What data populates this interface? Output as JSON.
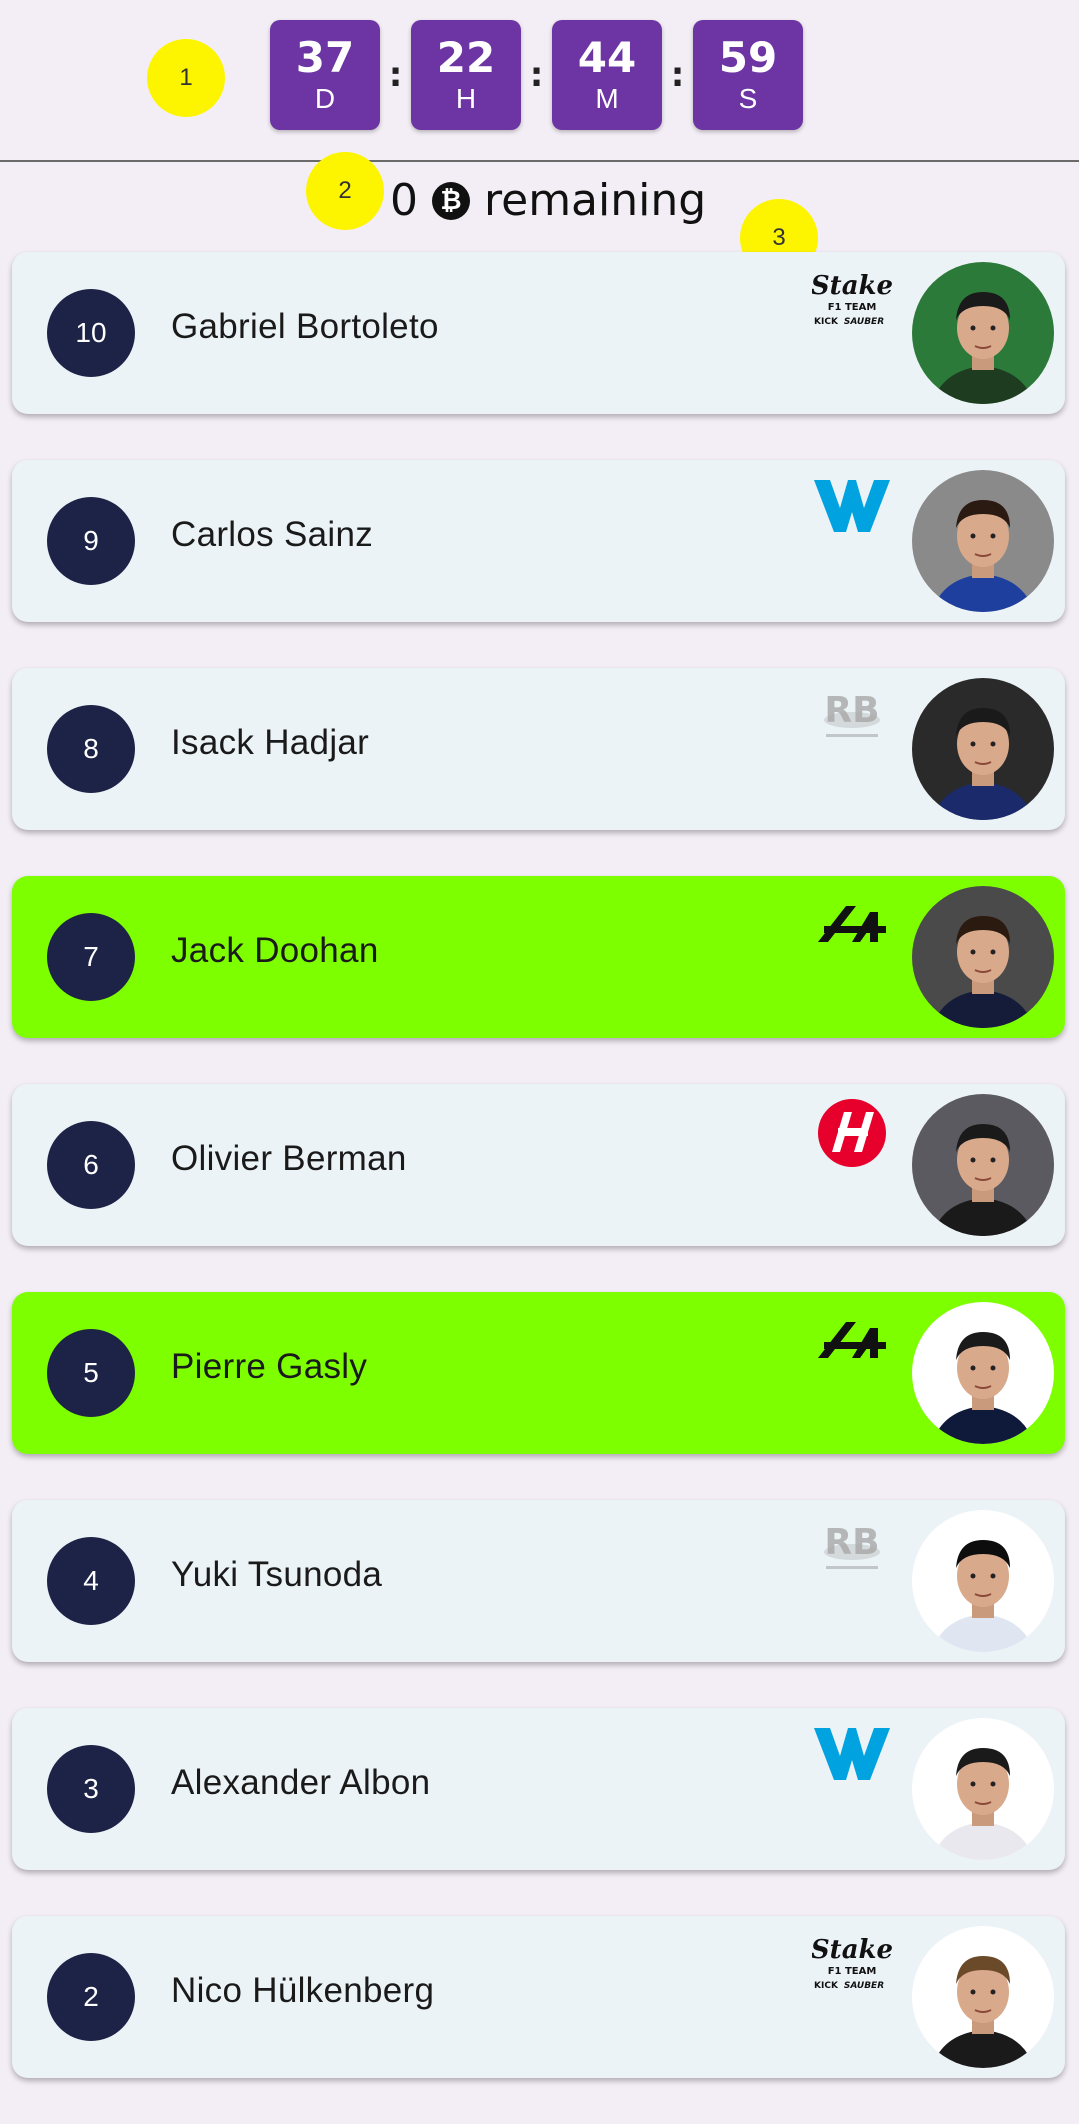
{
  "countdown": [
    {
      "value": "37",
      "unit": "D"
    },
    {
      "value": "22",
      "unit": "H"
    },
    {
      "value": "44",
      "unit": "M"
    },
    {
      "value": "59",
      "unit": "S"
    }
  ],
  "separator": ":",
  "balance": {
    "amount": "0",
    "coin_symbol": "₿",
    "label": "remaining"
  },
  "markers": [
    "1",
    "2",
    "3"
  ],
  "drivers": [
    {
      "position": "10",
      "name": "Gabriel Bortoleto",
      "team": "stake-sauber",
      "selected": false
    },
    {
      "position": "9",
      "name": "Carlos Sainz",
      "team": "williams",
      "selected": false
    },
    {
      "position": "8",
      "name": "Isack Hadjar",
      "team": "racing-bulls",
      "selected": false
    },
    {
      "position": "7",
      "name": "Jack Doohan",
      "team": "alpine",
      "selected": true
    },
    {
      "position": "6",
      "name": "Olivier Berman",
      "team": "haas",
      "selected": false
    },
    {
      "position": "5",
      "name": "Pierre Gasly",
      "team": "alpine",
      "selected": true
    },
    {
      "position": "4",
      "name": "Yuki Tsunoda",
      "team": "racing-bulls",
      "selected": false
    },
    {
      "position": "3",
      "name": "Alexander Albon",
      "team": "williams",
      "selected": false
    },
    {
      "position": "2",
      "name": "Nico Hülkenberg",
      "team": "stake-sauber",
      "selected": false
    }
  ],
  "logo_text": {
    "stake_sauber": {
      "brand": "Stake",
      "sub": "F1 TEAM",
      "kick": "KICK",
      "sauber": "SAUBER"
    },
    "racing_bulls": {
      "brand": "RB"
    }
  },
  "colors": {
    "background": "#f3eef5",
    "countdown_box": "#6c35a3",
    "card": "#ecf3f7",
    "card_selected": "#7dff00",
    "position_badge": "#1d2347",
    "marker": "#fdf500",
    "williams": "#00a3e0",
    "haas": "#e6002b",
    "racing_bulls": "#a8a8a8"
  }
}
